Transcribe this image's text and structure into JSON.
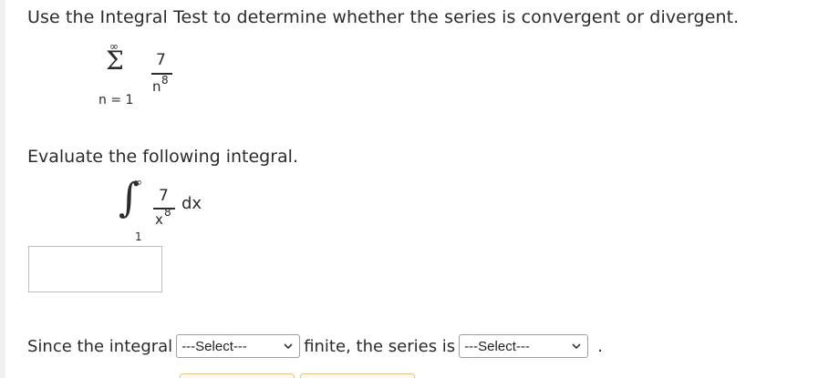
{
  "question": "Use the Integral Test to determine whether the series is convergent or divergent.",
  "series": {
    "upper": "∞",
    "sigma": "Σ",
    "lower": "n = 1",
    "numerator": "7",
    "denominator_base": "n",
    "denominator_exp": "8"
  },
  "evaluate_prompt": "Evaluate the following integral.",
  "integral": {
    "sign": "∫",
    "upper": "∞",
    "lower": "1",
    "numerator": "7",
    "denominator_base": "x",
    "denominator_exp": "8",
    "differential": "dx"
  },
  "answer_input": {
    "value": ""
  },
  "sentence": {
    "part1": "Since the integral",
    "select1": "---Select---",
    "part2": "finite, the series is",
    "select2": "---Select---",
    "end": "."
  },
  "colors": {
    "text": "#2b2b2b",
    "input_border": "#bdbdbd",
    "select_border": "#9e9e9e",
    "button_border": "#e0c58a"
  }
}
